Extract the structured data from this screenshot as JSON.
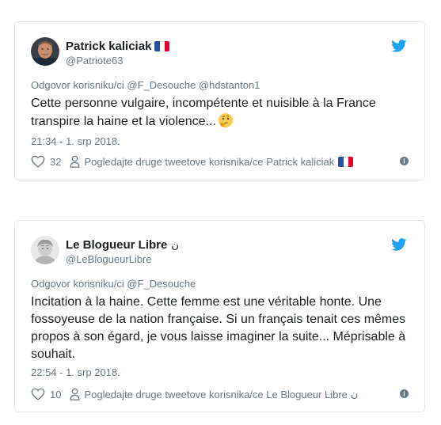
{
  "tweets": [
    {
      "display_name": "Patrick kaliciak",
      "handle": "@Patriote63",
      "reply_to": "Odgovor korisniku/ci @F_Desouche @hdstanton1",
      "text": "Cette personne vulgaire, incompétente et nuisible à la France transpire la haine et la violence...",
      "emoji": "thinking-face",
      "timestamp": "21:34 - 1. srp 2018.",
      "likes": "32",
      "profile_link": "Pogledajte druge tweetove korisnika/ce Patrick kaliciak",
      "flag_colors": [
        "#2450a4",
        "#ffffff",
        "#e4002b"
      ]
    },
    {
      "display_name": "Le Blogueur Libre",
      "name_suffix": "ن",
      "handle": "@LeBlogueurLibre",
      "reply_to": "Odgovor korisniku/ci @F_Desouche",
      "text": "Incitation à la haine. Cette femme est une véritable honte. Une fossoyeuse de la nation française. Si un français tenait ces mêmes propos à son égard, je vous laisse imaginer la suite... Méprisable à souhait.",
      "timestamp": "22:54 - 1. srp 2018.",
      "likes": "10",
      "profile_link": "Pogledajte druge tweetove korisnika/ce Le Blogueur Libre",
      "profile_link_suffix": "ن"
    }
  ],
  "colors": {
    "twitter_blue": "#1da1f2",
    "secondary_text": "#697882",
    "primary_text": "#1c2022",
    "border": "#e1e8ed"
  }
}
